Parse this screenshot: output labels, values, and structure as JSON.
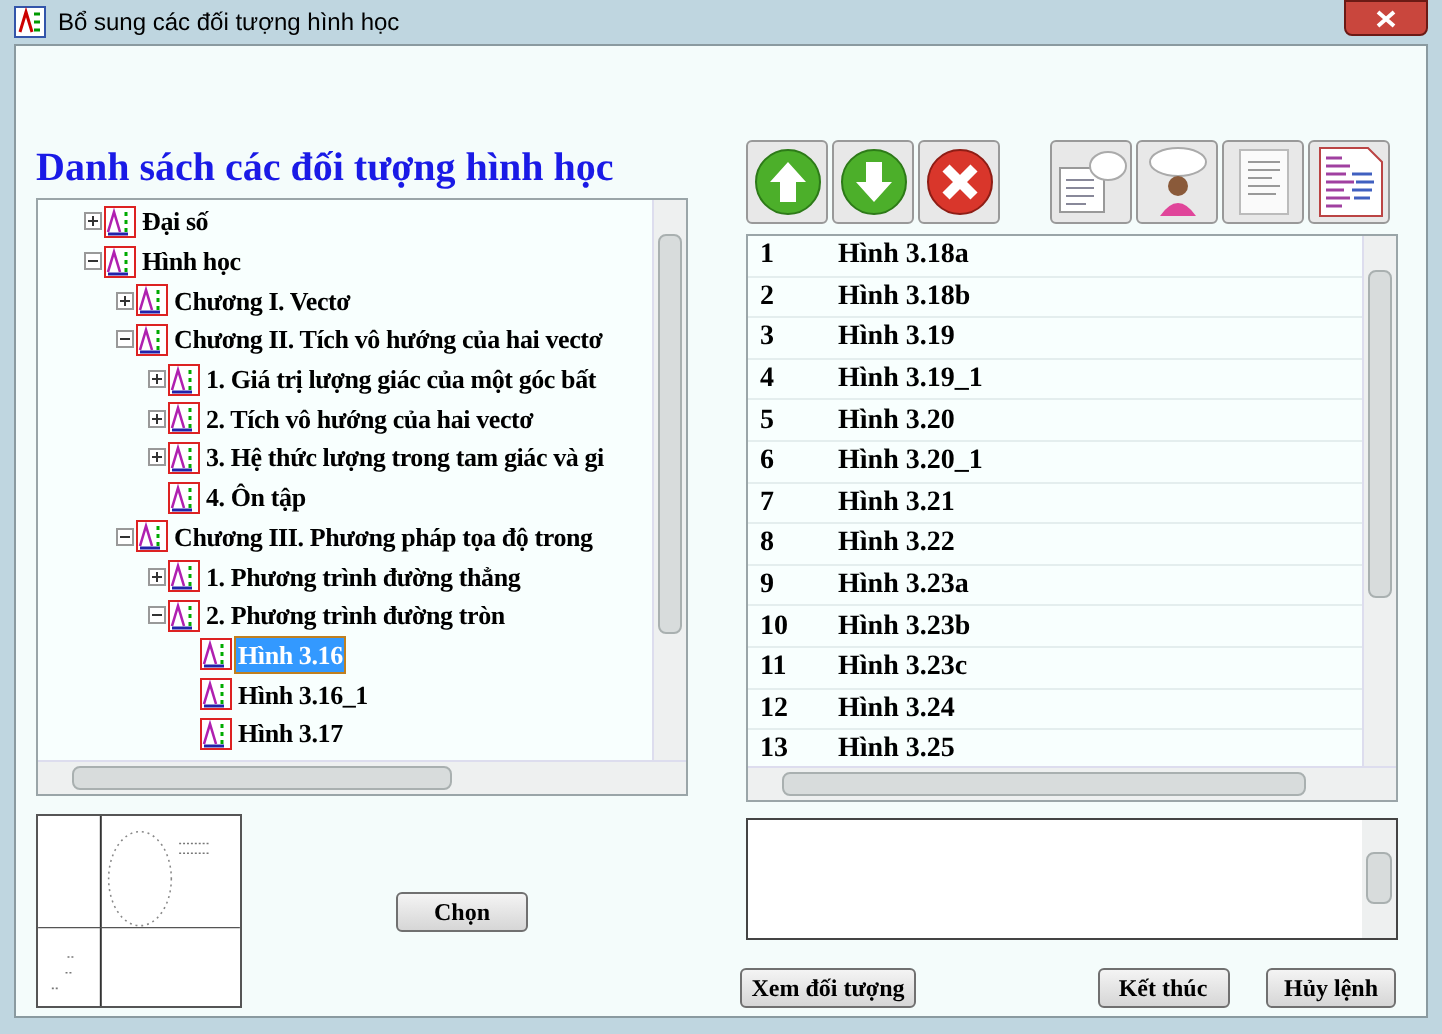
{
  "window": {
    "title": "Bổ sung các đối tượng hình học"
  },
  "heading": "Danh sách các đối tượng hình học",
  "tree": [
    {
      "label": "Đại số",
      "expanded": false,
      "selected": false
    },
    {
      "label": "Hình học",
      "expanded": true,
      "selected": false,
      "children": [
        {
          "label": "Chương I. Vectơ",
          "expanded": false,
          "selected": false
        },
        {
          "label": "Chương II. Tích vô hướng của hai vectơ",
          "expanded": true,
          "selected": false,
          "children": [
            {
              "label": "1. Giá trị lượng giác của một góc bất",
              "expanded": false,
              "selected": false
            },
            {
              "label": "2. Tích vô hướng của hai vectơ",
              "expanded": false,
              "selected": false
            },
            {
              "label": "3. Hệ thức lượng trong tam giác và gi",
              "expanded": false,
              "selected": false
            },
            {
              "label": "4. Ôn tập",
              "selected": false
            }
          ]
        },
        {
          "label": "Chương III. Phương pháp tọa độ trong",
          "expanded": true,
          "selected": false,
          "children": [
            {
              "label": "1. Phương trình đường thẳng",
              "expanded": false,
              "selected": false
            },
            {
              "label": "2. Phương trình đường tròn",
              "expanded": true,
              "selected": false,
              "children": [
                {
                  "label": "Hình 3.16",
                  "selected": true
                },
                {
                  "label": "Hình 3.16_1",
                  "selected": false
                },
                {
                  "label": "Hình 3.17",
                  "selected": false
                }
              ]
            }
          ]
        }
      ]
    }
  ],
  "select_button": "Chọn",
  "list": [
    {
      "number": "1",
      "name": "Hình 3.18a"
    },
    {
      "number": "2",
      "name": "Hình 3.18b"
    },
    {
      "number": "3",
      "name": "Hình 3.19"
    },
    {
      "number": "4",
      "name": "Hình 3.19_1"
    },
    {
      "number": "5",
      "name": "Hình 3.20"
    },
    {
      "number": "6",
      "name": "Hình 3.20_1"
    },
    {
      "number": "7",
      "name": "Hình 3.21"
    },
    {
      "number": "8",
      "name": "Hình 3.22"
    },
    {
      "number": "9",
      "name": "Hình 3.23a"
    },
    {
      "number": "10",
      "name": "Hình 3.23b"
    },
    {
      "number": "11",
      "name": "Hình 3.23c"
    },
    {
      "number": "12",
      "name": "Hình 3.24"
    },
    {
      "number": "13",
      "name": "Hình 3.25"
    }
  ],
  "buttons": [
    {
      "label": "Xem đối tượng"
    },
    {
      "label": "Kết thúc"
    },
    {
      "label": "Hủy lệnh"
    }
  ]
}
